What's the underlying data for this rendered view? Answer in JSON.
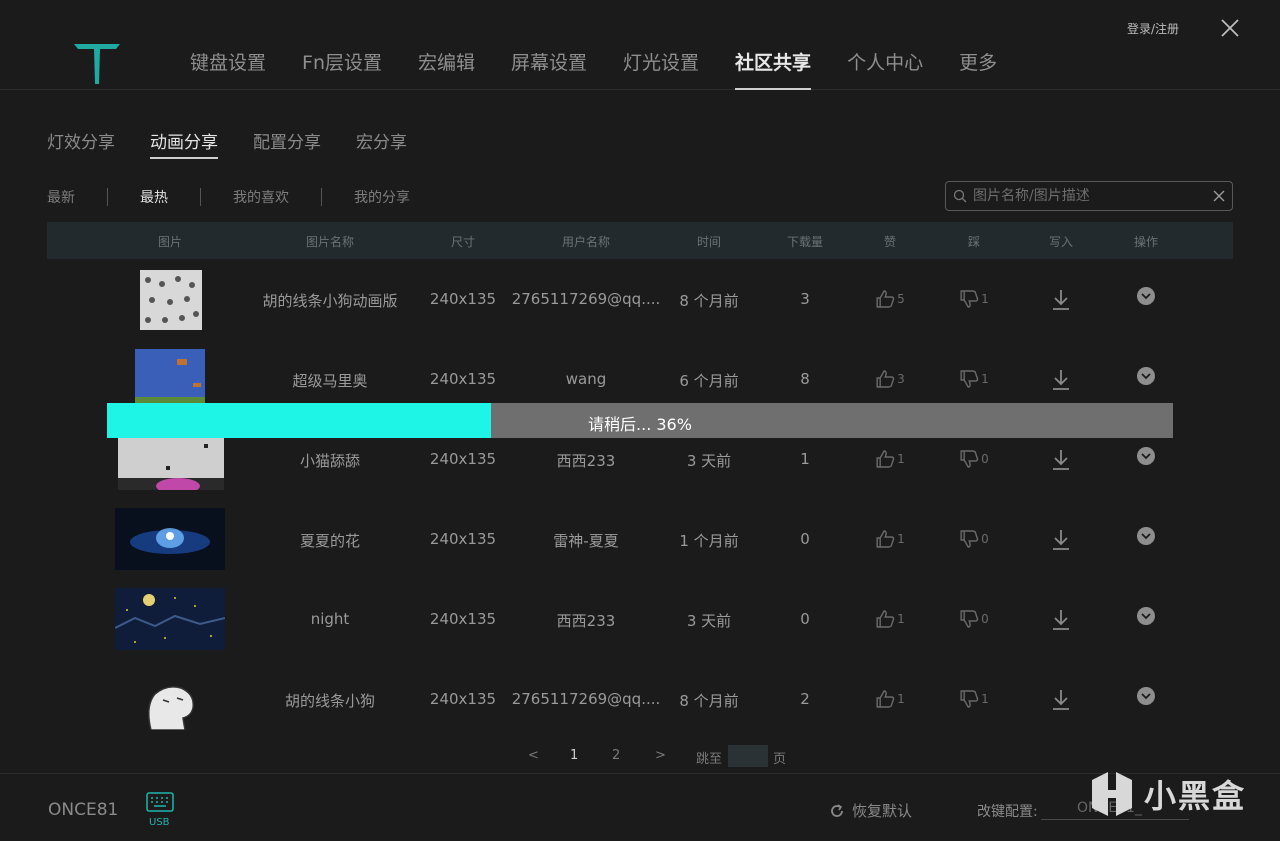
{
  "header": {
    "nav": [
      "键盘设置",
      "Fn层设置",
      "宏编辑",
      "屏幕设置",
      "灯光设置",
      "社区共享",
      "个人中心",
      "更多"
    ],
    "active_nav": "社区共享",
    "login": "登录/注册"
  },
  "subtabs": [
    "灯效分享",
    "动画分享",
    "配置分享",
    "宏分享"
  ],
  "filters": [
    "最新",
    "最热",
    "我的喜欢",
    "我的分享"
  ],
  "search": {
    "placeholder": "图片名称/图片描述"
  },
  "table": {
    "headers": [
      "图片",
      "图片名称",
      "尺寸",
      "用户名称",
      "时间",
      "下载量",
      "赞",
      "踩",
      "写入",
      "操作"
    ],
    "rows": [
      {
        "name": "胡的线条小狗动画版",
        "size": "240x135",
        "user": "2765117269@qq....",
        "time": "8 个月前",
        "downloads": "3",
        "likes": "5",
        "dislikes": "1"
      },
      {
        "name": "超级马里奥",
        "size": "240x135",
        "user": "wang",
        "time": "6 个月前",
        "downloads": "8",
        "likes": "3",
        "dislikes": "1"
      },
      {
        "name": "小猫舔舔",
        "size": "240x135",
        "user": "西西233",
        "time": "3 天前",
        "downloads": "1",
        "likes": "1",
        "dislikes": "0"
      },
      {
        "name": "夏夏的花",
        "size": "240x135",
        "user": "雷神-夏夏",
        "time": "1 个月前",
        "downloads": "0",
        "likes": "1",
        "dislikes": "0"
      },
      {
        "name": "night",
        "size": "240x135",
        "user": "西西233",
        "time": "3 天前",
        "downloads": "0",
        "likes": "1",
        "dislikes": "0"
      },
      {
        "name": "胡的线条小狗",
        "size": "240x135",
        "user": "2765117269@qq....",
        "time": "8 个月前",
        "downloads": "2",
        "likes": "1",
        "dislikes": "1"
      }
    ]
  },
  "progress": {
    "text": "请稍后... 36%",
    "value": 0.36,
    "fill_color": "#1ff5e6"
  },
  "pagination": {
    "prev": "<",
    "pages": [
      "1",
      "2"
    ],
    "next": ">",
    "jump_label": "跳至",
    "page_suffix": "页"
  },
  "footer": {
    "device": "ONCE81",
    "usb_label": "USB",
    "restore": "恢复默认",
    "key_config_label": "改键配置:",
    "key_config_value": "ONCE81_"
  },
  "watermark": "小黑盒",
  "colors": {
    "accent": "#1fb5ad",
    "progress": "#1ff5e6"
  }
}
